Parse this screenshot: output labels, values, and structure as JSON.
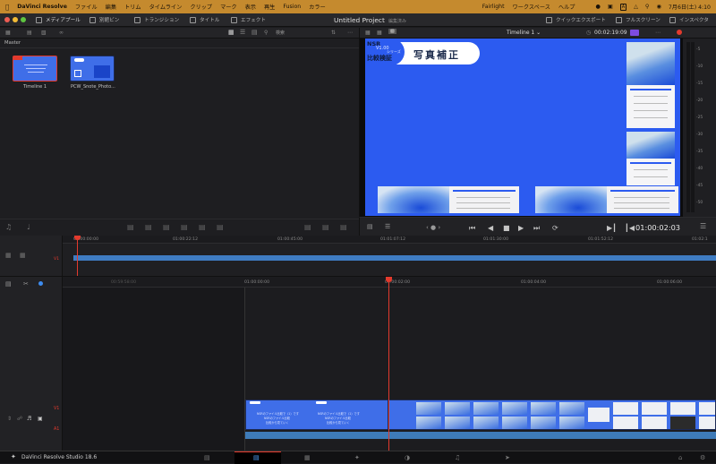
{
  "menubar": {
    "apple_icon": "apple-icon",
    "app": "DaVinci Resolve",
    "items": [
      "ファイル",
      "編集",
      "トリム",
      "タイムライン",
      "クリップ",
      "マーク",
      "表示",
      "再生",
      "Fusion",
      "カラー",
      "Fairlight",
      "ワークスペース",
      "ヘルプ"
    ],
    "status_text": "A",
    "clock": "7月6日(土) 4:10"
  },
  "toolbar": {
    "media_pool": "メディアプール",
    "effects_bin": "別館ビン",
    "transitions": "トランジション",
    "titles": "タイトル",
    "effects": "エフェクト",
    "project_title": "Untitled Project",
    "edited": "編集済み",
    "quick_export": "クイックエクスポート",
    "fullscreen": "フルスクリーン",
    "inspector": "インスペクタ"
  },
  "media_pool": {
    "search_placeholder": "検索",
    "bin_name": "Master",
    "clips": [
      {
        "name": "Timeline 1"
      },
      {
        "name": "PCW_Snote_Photo..."
      }
    ]
  },
  "viewer": {
    "timeline_selector": "Timeline 1",
    "timecode": "00:02:19:09",
    "playhead_tc": "01:00:02:03",
    "frame": {
      "badge_top": "NSR",
      "badge_mid": "V1.00",
      "badge_small": "シリーズ",
      "badge_main": "比較検証",
      "title": "写真補正"
    },
    "meter_ticks": [
      "-5",
      "-10",
      "-15",
      "-20",
      "-25",
      "-30",
      "-35",
      "-40",
      "-45",
      "-50"
    ]
  },
  "timeline_mini": {
    "ticks": [
      "01:00:00:00",
      "01:00:22:12",
      "01:00:45:00",
      "01:01:07:12",
      "01:01:30:00",
      "01:01:52:12",
      "01:02:1"
    ],
    "track": "V1"
  },
  "timeline": {
    "ticks": [
      "00:59:58:00",
      "01:00:00:00",
      "01:00:02:00",
      "01:00:04:00",
      "01:00:06:00"
    ],
    "tracks": [
      "V1",
      "A1"
    ],
    "clip_lines": [
      "NSRのファイル比較で（1）です",
      "NSRのファイル比較",
      "比較から見ていく"
    ]
  },
  "bottombar": {
    "app_name": "DaVinci Resolve Studio 18.6"
  },
  "colors": {
    "menubar": "#c58a2e",
    "accent_red": "#e33a2d",
    "frame_blue": "#2c5bf0",
    "clip_blue": "#3f6ee8",
    "audio_blue": "#3e7bb8"
  }
}
